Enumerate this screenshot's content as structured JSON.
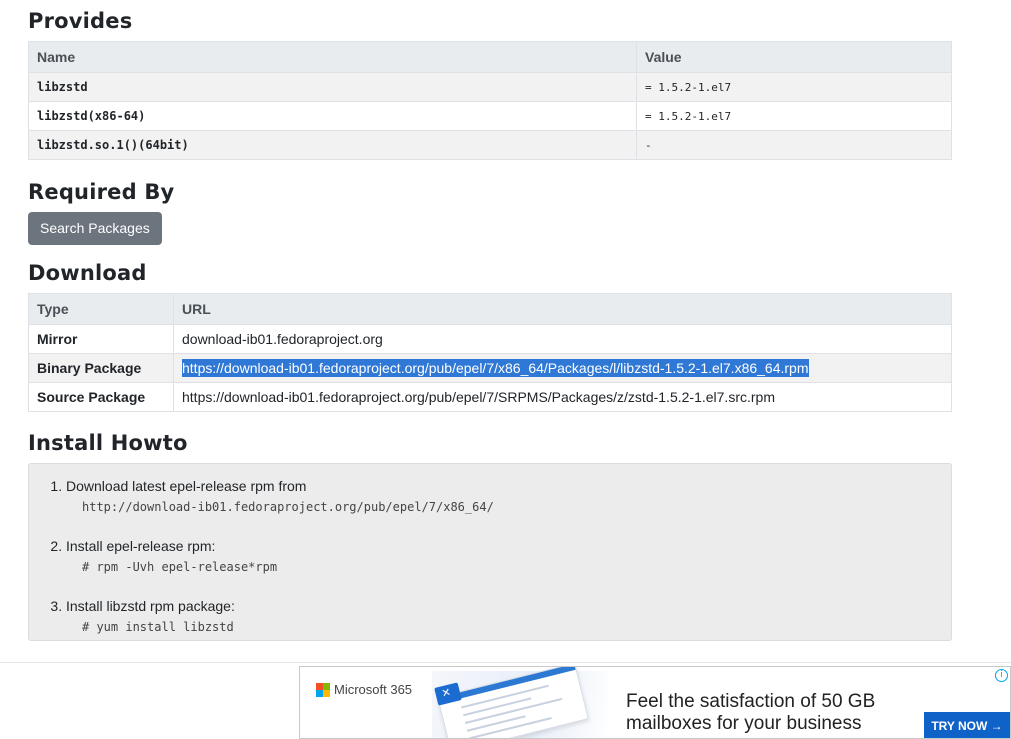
{
  "provides": {
    "title": "Provides",
    "headers": [
      "Name",
      "Value"
    ],
    "rows": [
      {
        "name": "libzstd",
        "value": "= 1.5.2-1.el7"
      },
      {
        "name": "libzstd(x86-64)",
        "value": "= 1.5.2-1.el7"
      },
      {
        "name": "libzstd.so.1()(64bit)",
        "value": "-"
      }
    ]
  },
  "required_by": {
    "title": "Required By",
    "button_label": "Search Packages"
  },
  "download": {
    "title": "Download",
    "headers": [
      "Type",
      "URL"
    ],
    "rows": [
      {
        "type": "Mirror",
        "url": "download-ib01.fedoraproject.org"
      },
      {
        "type": "Binary Package",
        "url": "https://download-ib01.fedoraproject.org/pub/epel/7/x86_64/Packages/l/libzstd-1.5.2-1.el7.x86_64.rpm",
        "selected": true
      },
      {
        "type": "Source Package",
        "url": "https://download-ib01.fedoraproject.org/pub/epel/7/SRPMS/Packages/z/zstd-1.5.2-1.el7.src.rpm"
      }
    ]
  },
  "install_howto": {
    "title": "Install Howto",
    "steps": [
      {
        "text": "Download latest epel-release rpm from",
        "code": "http://download-ib01.fedoraproject.org/pub/epel/7/x86_64/"
      },
      {
        "text": "Install epel-release rpm:",
        "code": "# rpm -Uvh epel-release*rpm"
      },
      {
        "text": "Install libzstd rpm package:",
        "code": "# yum install libzstd"
      }
    ]
  },
  "ad": {
    "brand": "Microsoft 365",
    "headline_line1": "Feel the satisfaction of 50 GB",
    "headline_line2": "mailboxes for your business",
    "cta": "TRY NOW →",
    "info_icon": "i",
    "logo_colors": [
      "#f25022",
      "#7fba00",
      "#00a4ef",
      "#ffb900"
    ]
  },
  "colors": {
    "selection": "#2f78d5",
    "button": "#6c757d",
    "cta": "#0e62c8"
  }
}
